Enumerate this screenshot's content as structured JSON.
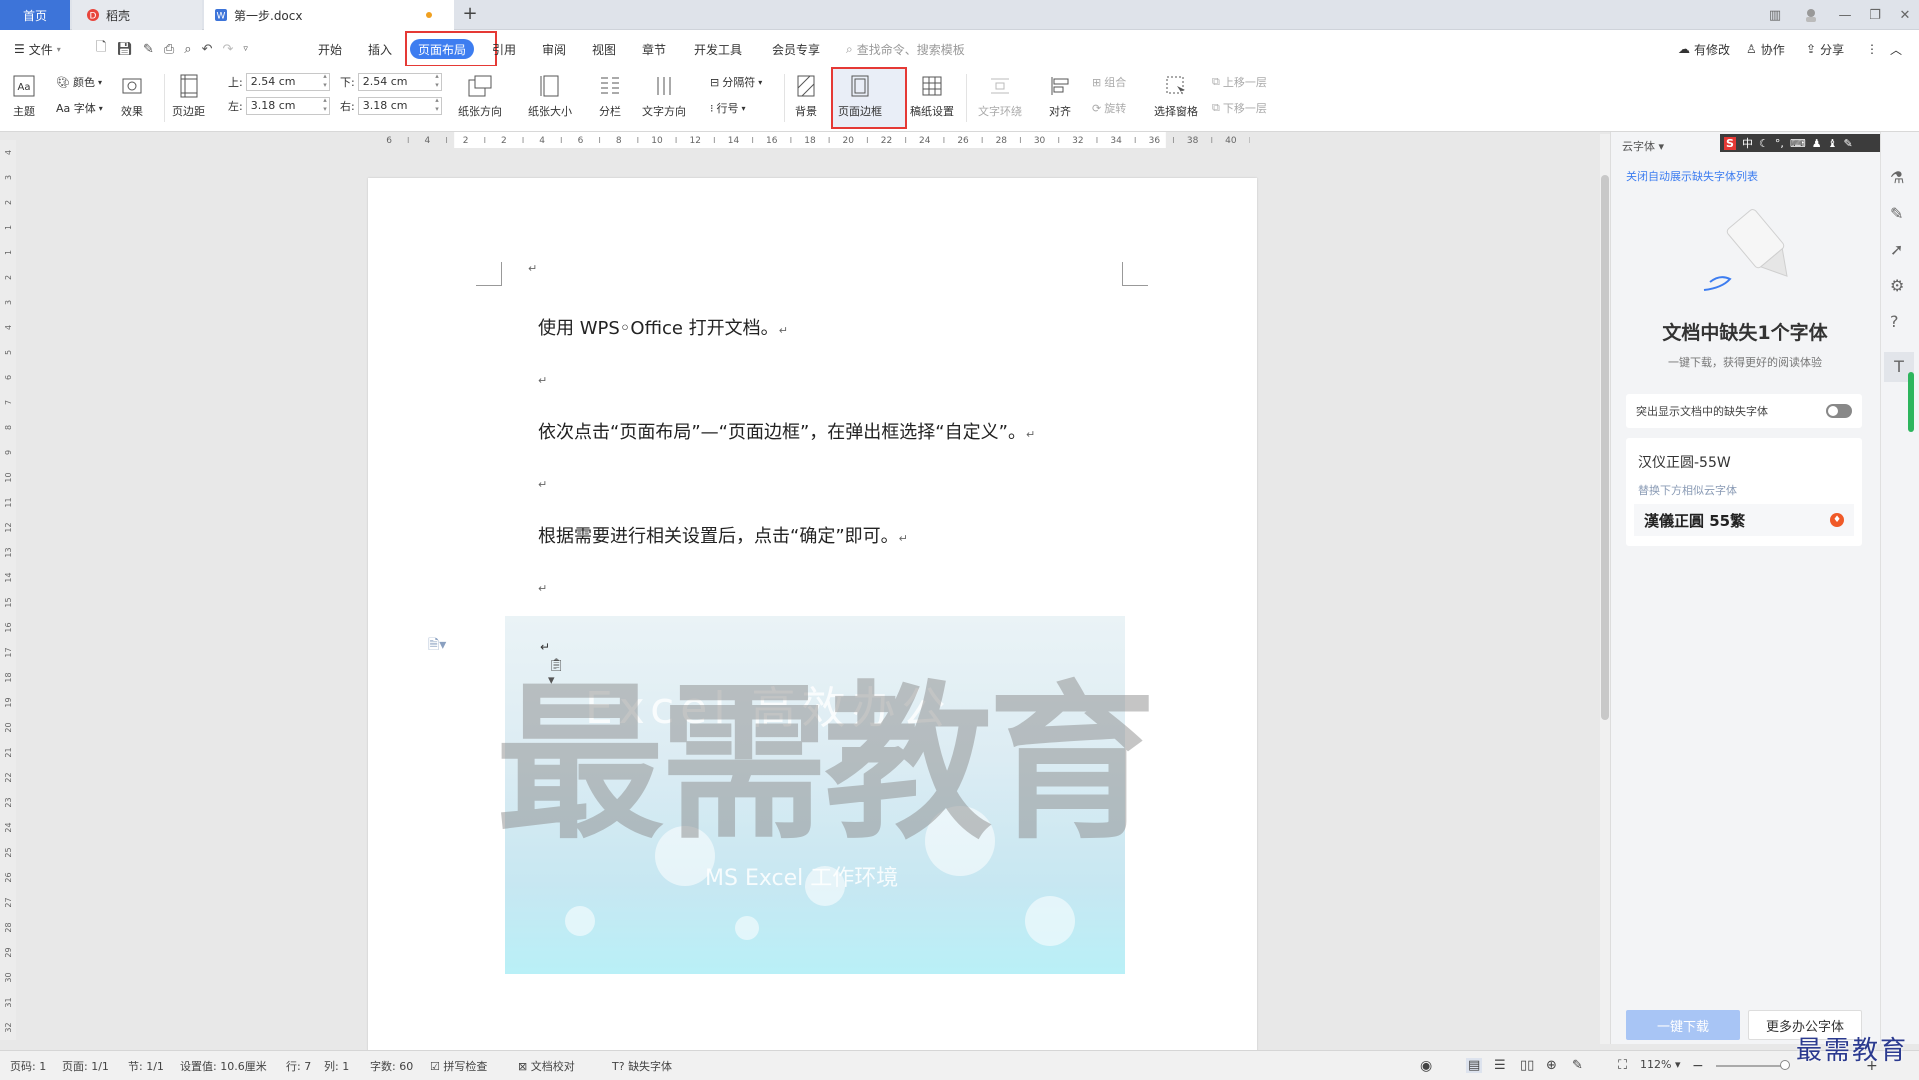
{
  "tabs": {
    "home": "首页",
    "daoke": "稻壳",
    "doc": "第一步.docx",
    "add": "+"
  },
  "menu": {
    "file": "文件",
    "items": [
      "开始",
      "插入",
      "页面布局",
      "引用",
      "审阅",
      "视图",
      "章节",
      "开发工具",
      "会员专享"
    ],
    "search_placeholder": "查找命令、搜索模板",
    "right": {
      "modified": "有修改",
      "collab": "协作",
      "share": "分享"
    }
  },
  "ribbon": {
    "theme": "主题",
    "color": "颜色",
    "font": "Aa 字体",
    "effect": "效果",
    "margins": "页边距",
    "top_label": "上:",
    "top_val": "2.54 cm",
    "bottom_label": "下:",
    "bottom_val": "2.54 cm",
    "left_label": "左:",
    "left_val": "3.18 cm",
    "right_label": "右:",
    "right_val": "3.18 cm",
    "orientation": "纸张方向",
    "size": "纸张大小",
    "columns": "分栏",
    "text_dir": "文字方向",
    "separator": "分隔符",
    "line_num": "行号",
    "background": "背景",
    "page_border": "页面边框",
    "manuscript": "稿纸设置",
    "text_wrap": "文字环绕",
    "align": "对齐",
    "group": "组合",
    "rotate": "旋转",
    "select_pane": "选择窗格",
    "bring_forward": "上移一层",
    "send_backward": "下移一层"
  },
  "ruler": {
    "h": [
      "6",
      "4",
      "2",
      "2",
      "4",
      "6",
      "8",
      "10",
      "12",
      "14",
      "16",
      "18",
      "20",
      "22",
      "24",
      "26",
      "28",
      "30",
      "32",
      "34",
      "36",
      "38",
      "40"
    ],
    "v": [
      "4",
      "3",
      "2",
      "1",
      "1",
      "2",
      "3",
      "4",
      "5",
      "6",
      "7",
      "8",
      "9",
      "10",
      "11",
      "12",
      "13",
      "14",
      "15",
      "16",
      "17",
      "18",
      "19",
      "20",
      "21",
      "22",
      "23",
      "24",
      "25",
      "26",
      "27",
      "28",
      "29",
      "30",
      "31",
      "32"
    ]
  },
  "document": {
    "para_mark": "↵",
    "p1": "使用 WPS◦Office 打开文档。",
    "p2": "依次点击“页面布局”—“页面边框”，在弹出框选择“自定义”。",
    "p3": "根据需要进行相关设置后，点击“确定”即可。",
    "image_text": {
      "top": "Excel 高效办公",
      "watermark": "最需教育",
      "bottom": "MS Excel 工作环境"
    }
  },
  "panel": {
    "header": "云字体",
    "close_link": "关闭自动展示缺失字体列表",
    "title": "文档中缺失1个字体",
    "subtitle": "一键下载，获得更好的阅读体验",
    "toggle_label": "突出显示文档中的缺失字体",
    "font_name": "汉仪正圆-55W",
    "replace_hint": "替换下方相似云字体",
    "replacement": "漢儀正圓 55繁",
    "download_btn": "一键下载",
    "more_btn": "更多办公字体"
  },
  "statusbar": {
    "page_code": "页码: 1",
    "page": "页面: 1/1",
    "section": "节: 1/1",
    "setting": "设置值: 10.6厘米",
    "row": "行: 7",
    "col": "列: 1",
    "words": "字数: 60",
    "spell": "拼写检查",
    "proof": "文档校对",
    "missing_font": "缺失字体",
    "zoom": "112%"
  },
  "brand_watermark": "最需教育",
  "colors": {
    "accent": "#3d7df0",
    "highlight": "#e53935",
    "home_tab": "#3d74d9"
  }
}
